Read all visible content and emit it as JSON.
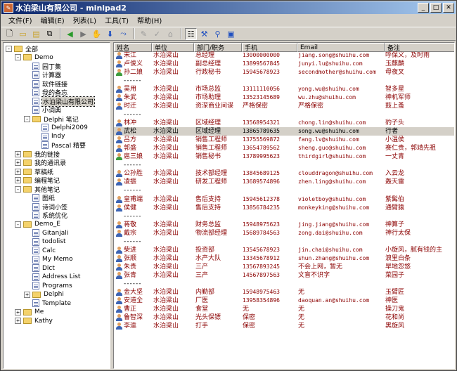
{
  "window": {
    "title": "水泊梁山有限公司 - minipad2"
  },
  "menus": [
    "文件(F)",
    "编辑(E)",
    "列表(L)",
    "工具(T)",
    "帮助(H)"
  ],
  "tree": [
    {
      "label": "全部",
      "level": 0,
      "type": "folder",
      "exp": "-"
    },
    {
      "label": "Demo",
      "level": 1,
      "type": "folder",
      "exp": "-"
    },
    {
      "label": "园丁集",
      "level": 2,
      "type": "doc"
    },
    {
      "label": "计算器",
      "level": 2,
      "type": "doc"
    },
    {
      "label": "软件链接",
      "level": 2,
      "type": "doc"
    },
    {
      "label": "我的备忘",
      "level": 2,
      "type": "doc"
    },
    {
      "label": "水泊梁山有限公司",
      "level": 2,
      "type": "doc",
      "selected": true
    },
    {
      "label": "小词典",
      "level": 2,
      "type": "doc"
    },
    {
      "label": "Delphi 笔记",
      "level": 2,
      "type": "folder",
      "exp": "-"
    },
    {
      "label": "Delphi2009",
      "level": 3,
      "type": "doc"
    },
    {
      "label": "Indy",
      "level": 3,
      "type": "doc"
    },
    {
      "label": "Pascal 精要",
      "level": 3,
      "type": "doc"
    },
    {
      "label": "我的链接",
      "level": 1,
      "type": "folder",
      "exp": "+"
    },
    {
      "label": "我的通讯录",
      "level": 1,
      "type": "folder",
      "exp": "+"
    },
    {
      "label": "草稿纸",
      "level": 1,
      "type": "folder",
      "exp": "+"
    },
    {
      "label": "编程笔记",
      "level": 1,
      "type": "folder",
      "exp": "+"
    },
    {
      "label": "其他笔记",
      "level": 1,
      "type": "folder",
      "exp": "-"
    },
    {
      "label": "图纸",
      "level": 2,
      "type": "doc"
    },
    {
      "label": "诗词小签",
      "level": 2,
      "type": "doc"
    },
    {
      "label": "系统优化",
      "level": 2,
      "type": "doc"
    },
    {
      "label": "Demo_E",
      "level": 1,
      "type": "folder",
      "exp": "-"
    },
    {
      "label": "Gitanjali",
      "level": 2,
      "type": "doc"
    },
    {
      "label": "todolist",
      "level": 2,
      "type": "doc"
    },
    {
      "label": "Calc",
      "level": 2,
      "type": "doc"
    },
    {
      "label": "My Memo",
      "level": 2,
      "type": "doc"
    },
    {
      "label": "Dict",
      "level": 2,
      "type": "doc"
    },
    {
      "label": "Address List",
      "level": 2,
      "type": "doc"
    },
    {
      "label": "Programs",
      "level": 2,
      "type": "doc"
    },
    {
      "label": "Delphi",
      "level": 2,
      "type": "folder",
      "exp": "+"
    },
    {
      "label": "Template",
      "level": 2,
      "type": "doc"
    },
    {
      "label": "Me",
      "level": 1,
      "type": "folder",
      "exp": "+"
    },
    {
      "label": "Kathy",
      "level": 1,
      "type": "folder",
      "exp": "+"
    }
  ],
  "columns": [
    "姓名",
    "单位",
    "部门/职务",
    "手机",
    "Email",
    "备注"
  ],
  "rows": [
    {
      "name": "宋江",
      "unit": "水泊梁山",
      "dept": "总经理",
      "phone": "13000000000",
      "email": "jiang.song@shuihu.com",
      "note": "呼保义，及时雨"
    },
    {
      "name": "卢俊义",
      "unit": "水泊梁山",
      "dept": "副总经理",
      "phone": "13899567845",
      "email": "junyi.lu@shuihu.com",
      "note": "玉麒麟"
    },
    {
      "name": "孙二娘",
      "unit": "水泊梁山",
      "dept": "行政秘书",
      "phone": "15945678923",
      "email": "secondmother@shuihu.com",
      "note": "母夜叉",
      "female": true
    },
    {
      "sep": "------"
    },
    {
      "name": "吴用",
      "unit": "水泊梁山",
      "dept": "市场总监",
      "phone": "13111110056",
      "email": "yong.wu@shuihu.com",
      "note": "智多星"
    },
    {
      "name": "朱武",
      "unit": "水泊梁山",
      "dept": "市场助理",
      "phone": "13523145689",
      "email": "wu.zhu@shuihu.com",
      "note": "神机军师"
    },
    {
      "name": "时迁",
      "unit": "水泊梁山",
      "dept": "资深商业间谍",
      "phone": "严格保密",
      "email": "严格保密",
      "note": "鼓上蚤"
    },
    {
      "sep": "------"
    },
    {
      "name": "林冲",
      "unit": "水泊梁山",
      "dept": "区域经理",
      "phone": "13568954321",
      "email": "chong.lin@shuihu.com",
      "note": "豹子头"
    },
    {
      "name": "武松",
      "unit": "水泊梁山",
      "dept": "区域经理",
      "phone": "13865789635",
      "email": "song.wu@shuihu.com",
      "note": "行者",
      "selected": true
    },
    {
      "name": "吕方",
      "unit": "水泊梁山",
      "dept": "销售工程师",
      "phone": "13755569872",
      "email": "fang.lv@shuihu.com",
      "note": "小温侯"
    },
    {
      "name": "郭盛",
      "unit": "水泊梁山",
      "dept": "销售工程师",
      "phone": "13654789562",
      "email": "sheng.guo@shuihu.com",
      "note": "赛仁贵，郭靖先祖"
    },
    {
      "name": "扈三娘",
      "unit": "水泊梁山",
      "dept": "销售秘书",
      "phone": "13789995623",
      "email": "thirdgirl@shuihu.com",
      "note": "一丈青",
      "female": true
    },
    {
      "sep": "------"
    },
    {
      "name": "公孙胜",
      "unit": "水泊梁山",
      "dept": "技术部经理",
      "phone": "13845689125",
      "email": "clouddragon@shuihu.com",
      "note": "入云龙"
    },
    {
      "name": "凌振",
      "unit": "水泊梁山",
      "dept": "研发工程师",
      "phone": "13689574896",
      "email": "zhen.ling@shuihu.com",
      "note": "轰天雷"
    },
    {
      "sep": "------"
    },
    {
      "name": "皇甫端",
      "unit": "水泊梁山",
      "dept": "售后支持",
      "phone": "15945612378",
      "email": "violetboy@shuihu.com",
      "note": "紫髯伯"
    },
    {
      "name": "侯健",
      "unit": "水泊梁山",
      "dept": "售后支持",
      "phone": "13856784235",
      "email": "monkeyking@shuihu.com",
      "note": "通臂猿"
    },
    {
      "sep": "------"
    },
    {
      "name": "蒋敬",
      "unit": "水泊梁山",
      "dept": "财务总监",
      "phone": "15948975623",
      "email": "jing.jiang@shuihu.com",
      "note": "神算子"
    },
    {
      "name": "戴宗",
      "unit": "水泊梁山",
      "dept": "物流部经理",
      "phone": "15689784563",
      "email": "zong.dai@shuihu.com",
      "note": "神行太保"
    },
    {
      "sep": "------"
    },
    {
      "name": "柴进",
      "unit": "水泊梁山",
      "dept": "投资部",
      "phone": "13545678923",
      "email": "jin.chai@shuihu.com",
      "note": "小旋风，腻有钱的主"
    },
    {
      "name": "张顺",
      "unit": "水泊梁山",
      "dept": "水产大队",
      "phone": "13345678912",
      "email": "shun.zhang@shuihu.com",
      "note": "浪里白条"
    },
    {
      "name": "朱贵",
      "unit": "水泊梁山",
      "dept": "三产",
      "phone": "13567893245",
      "email": "不会上网，暂无",
      "note": "旱地忽悠"
    },
    {
      "name": "张青",
      "unit": "水泊梁山",
      "dept": "三产",
      "phone": "14567897563",
      "email": "文盲不识字",
      "note": "菜园子"
    },
    {
      "sep": "------"
    },
    {
      "name": "金大坚",
      "unit": "水泊梁山",
      "dept": "内勤部",
      "phone": "15948975463",
      "email": "无",
      "note": "玉臂匠"
    },
    {
      "name": "安道全",
      "unit": "水泊梁山",
      "dept": "厂医",
      "phone": "13958354896",
      "email": "daoquan.an@shuihu.com",
      "note": "神医"
    },
    {
      "name": "曹正",
      "unit": "水泊梁山",
      "dept": "食堂",
      "phone": "无",
      "email": "无",
      "note": "操刀鬼"
    },
    {
      "name": "鲁智深",
      "unit": "水泊梁山",
      "dept": "光头保镖",
      "phone": "保密",
      "email": "无",
      "note": "花和尚"
    },
    {
      "name": "李逵",
      "unit": "水泊梁山",
      "dept": "打手",
      "phone": "保密",
      "email": "无",
      "note": "黑旋风"
    }
  ]
}
